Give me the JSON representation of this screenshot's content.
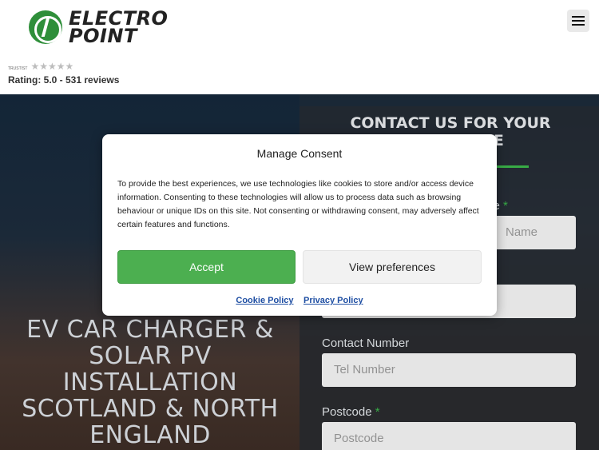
{
  "header": {
    "logo_line1": "ELECTRO",
    "logo_line2": "POINT",
    "trust_label": "TRUSTIST",
    "stars": "★★★★★",
    "rating_text": "Rating: 5.0 - 531 reviews"
  },
  "hero": {
    "title": "EV CAR CHARGER & SOLAR PV INSTALLATION SCOTLAND & NORTH ENGLAND"
  },
  "form": {
    "heading": "CONTACT US FOR YOUR FREE QUOTE",
    "name_label_partial": "me",
    "name_placeholder_partial": "Name",
    "contact_label": "Contact Number",
    "contact_placeholder": "Tel Number",
    "postcode_label": "Postcode",
    "postcode_placeholder": "Postcode",
    "required_mark": "*"
  },
  "consent": {
    "title": "Manage Consent",
    "body": "To provide the best experiences, we use technologies like cookies to store and/or access device information. Consenting to these technologies will allow us to process data such as browsing behaviour or unique IDs on this site. Not consenting or withdrawing consent, may adversely affect certain features and functions.",
    "accept_label": "Accept",
    "prefs_label": "View preferences",
    "cookie_policy": "Cookie Policy",
    "privacy_policy": "Privacy Policy"
  },
  "colors": {
    "brand_green": "#3bb54a",
    "accept_green": "#4caf50",
    "link_blue": "#1f4fa3"
  },
  "icons": [
    "logo-plug-icon",
    "hamburger-menu-icon",
    "star-rating-icon"
  ]
}
